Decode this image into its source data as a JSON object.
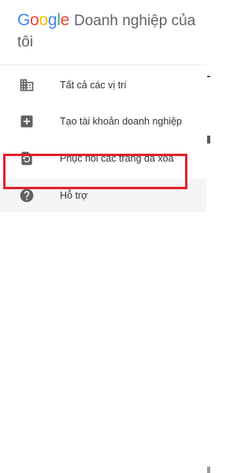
{
  "header": {
    "logo_letters": [
      "G",
      "o",
      "o",
      "g",
      "l",
      "e"
    ],
    "title_rest": "Doanh nghiệp của",
    "title_line2": "tôi"
  },
  "menu": {
    "items": [
      {
        "label": "Tất cả các vị trí",
        "icon": "building-icon"
      },
      {
        "label": "Tạo tài khoản doanh nghiệp",
        "icon": "add-box-icon"
      },
      {
        "label": "Phục hồi các trang đã xóa",
        "icon": "restore-page-icon"
      },
      {
        "label": "Hỗ trợ",
        "icon": "help-circle-icon",
        "highlighted": true
      }
    ]
  },
  "colors": {
    "google_blue": "#4285F4",
    "google_red": "#EA4335",
    "google_yellow": "#FBBC05",
    "google_green": "#34A853",
    "highlight_border": "#e0202e",
    "icon_gray": "#616161"
  }
}
